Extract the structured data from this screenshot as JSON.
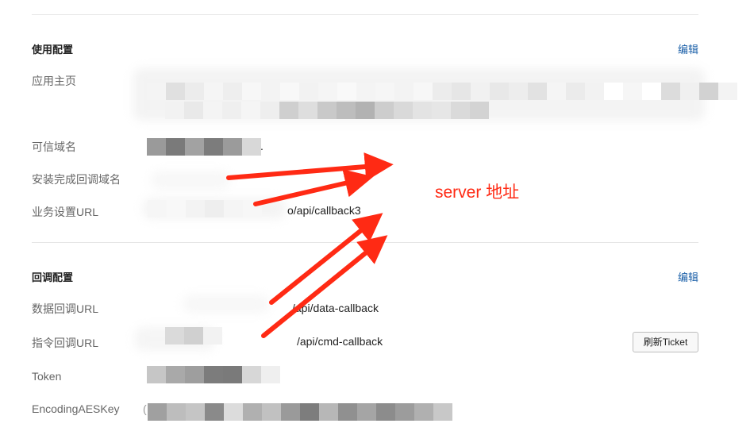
{
  "usage_config": {
    "title": "使用配置",
    "edit_label": "编辑",
    "rows": {
      "app_home": {
        "label": "应用主页"
      },
      "trusted_domain": {
        "label": "可信域名",
        "value_tail": "."
      },
      "install_callback_domain": {
        "label": "安装完成回调域名"
      },
      "business_url": {
        "label": "业务设置URL",
        "value": "o/api/callback3"
      }
    }
  },
  "callback_config": {
    "title": "回调配置",
    "edit_label": "编辑",
    "rows": {
      "data_callback": {
        "label": "数据回调URL",
        "value": "/api/data-callback"
      },
      "cmd_callback": {
        "label": "指令回调URL",
        "value": "/api/cmd-callback"
      },
      "token": {
        "label": "Token"
      },
      "aes_key": {
        "label": "EncodingAESKey",
        "value_head": "("
      }
    },
    "refresh_button_label": "刷新Ticket"
  },
  "annotation": {
    "text": "server 地址",
    "color": "#ff2a14"
  }
}
